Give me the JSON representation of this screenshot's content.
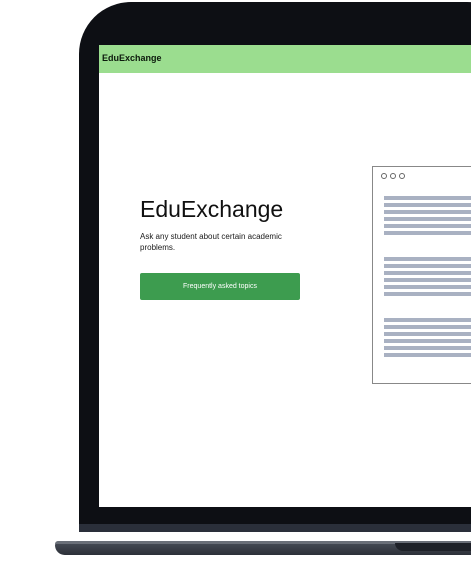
{
  "nav": {
    "brand": "EduExchange"
  },
  "hero": {
    "title": "EduExchange",
    "subtitle": "Ask any student about certain academic problems.",
    "cta_label": "Frequently asked topics"
  },
  "colors": {
    "nav_background": "#9bdd8f",
    "cta_background": "#3d9c4f",
    "laptop_bezel": "#0d0f14",
    "placeholder_line": "#a9b1c2"
  },
  "icons": {
    "window_controls": "three-hollow-circles",
    "document_lines": "placeholder-text-lines"
  }
}
